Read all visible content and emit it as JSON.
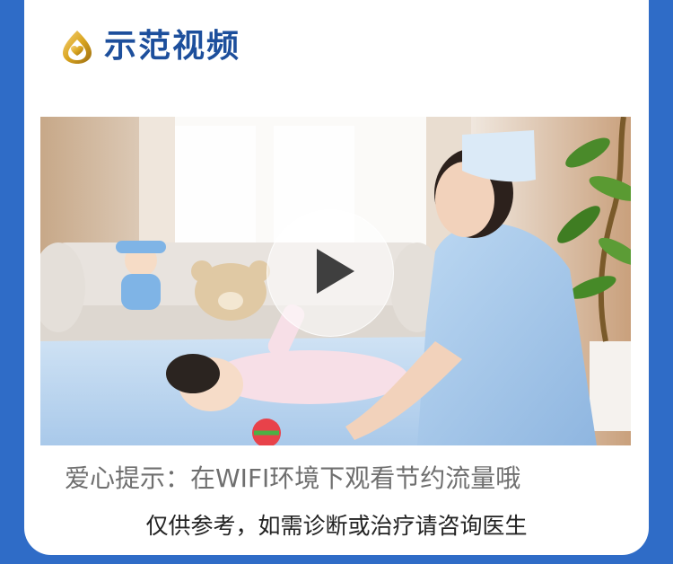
{
  "section": {
    "title": "示范视频",
    "logo_icon": "gold-heart-leaf-logo-icon"
  },
  "video": {
    "thumbnail": "nurse-with-baby-on-blue-mat",
    "play_icon": "play-icon"
  },
  "tip": {
    "text": "爱心提示：在WIFI环境下观看节约流量哦"
  },
  "disclaimer": {
    "text": "仅供参考，如需诊断或治疗请咨询医生"
  },
  "colors": {
    "background": "#2f6cc7",
    "card": "#ffffff",
    "title": "#1d4f9c",
    "tip": "#6f6f6f",
    "logo_gold": "#d9a520"
  }
}
